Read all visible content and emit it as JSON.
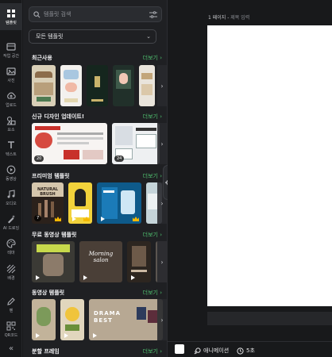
{
  "rail": {
    "items": [
      {
        "label": "템플릿",
        "icon": "template-icon"
      },
      {
        "label": "작업 공간",
        "icon": "workspace-icon"
      },
      {
        "label": "사진",
        "icon": "photo-icon"
      },
      {
        "label": "업로드",
        "icon": "upload-icon"
      },
      {
        "label": "요소",
        "icon": "elements-icon"
      },
      {
        "label": "텍스트",
        "icon": "text-icon"
      },
      {
        "label": "동영상",
        "icon": "video-icon"
      },
      {
        "label": "오디오",
        "icon": "audio-icon"
      },
      {
        "label": "AI 드로잉",
        "icon": "ai-drawing-icon"
      },
      {
        "label": "테마",
        "icon": "theme-icon"
      },
      {
        "label": "배경",
        "icon": "background-icon"
      },
      {
        "label": "펜",
        "icon": "pen-icon"
      },
      {
        "label": "QR코드",
        "icon": "qr-icon"
      }
    ]
  },
  "search": {
    "placeholder": "템플릿 검색"
  },
  "filter": {
    "selected": "모든 템플릿"
  },
  "sections": [
    {
      "title": "최근사용",
      "see_all": "더보기"
    },
    {
      "title": "신규 디자인 업데이트!",
      "see_all": "더보기",
      "badges": [
        "20",
        "24"
      ]
    },
    {
      "title": "프리미엄 템플릿",
      "see_all": "더보기",
      "badges": [
        "7"
      ],
      "thumb_text": [
        "NATURAL BRUSH"
      ]
    },
    {
      "title": "무료 동영상 템플릿",
      "see_all": "더보기",
      "thumb_text": [
        "Morning salon"
      ]
    },
    {
      "title": "동영상 템플릿",
      "see_all": "더보기",
      "thumb_text": [
        "DRAMA BEST"
      ]
    },
    {
      "title": "분할 프레임",
      "see_all": "더보기"
    }
  ],
  "canvas": {
    "page_label": "1 페이지 -",
    "page_title_placeholder": "제목 입력"
  },
  "bottom": {
    "animation_label": "애니메이션",
    "duration_label": "5초"
  },
  "colors": {
    "accent": "#4fc06f",
    "panel": "#1f2023",
    "page": "#ffffff"
  }
}
